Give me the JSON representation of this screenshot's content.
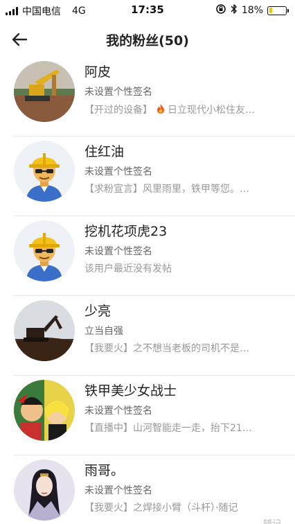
{
  "status_bar": {
    "carrier": "中国电信",
    "network": "4G",
    "time": "17:35",
    "battery_percent": "18%",
    "battery_level": 0.18,
    "icons": [
      "signal-icon",
      "orientation-lock-icon",
      "bluetooth-icon",
      "battery-icon"
    ]
  },
  "nav": {
    "back_icon": "back-arrow-icon",
    "title": "我的粉丝(50)"
  },
  "fans": [
    {
      "name": "阿皮",
      "signature": "未设置个性签名",
      "post_tag": "【开过的设备】",
      "post_icon": "fire-icon",
      "post_text": "日立现代小松住友…",
      "avatar": "excavator-photo"
    },
    {
      "name": "住红油",
      "signature": "未设置个性签名",
      "post_tag": "【求粉宣言】",
      "post_text": "风里雨里，铁甲等您。…",
      "avatar": "worker-cartoon"
    },
    {
      "name": "挖机花项虎23",
      "signature": "未设置个性签名",
      "post_tag": "",
      "post_text": "该用户最近没有发帖",
      "avatar": "worker-cartoon"
    },
    {
      "name": "少亮",
      "signature": "立当自强",
      "post_tag": "【我要火】",
      "post_text": "之不想当老板的司机不是…",
      "avatar": "excavator-silhouette-photo"
    },
    {
      "name": "铁甲美少女战士",
      "signature": "未设置个性签名",
      "post_tag": "【直播中】",
      "post_text": "山河智能走一走，抬下21…",
      "avatar": "anime-photo"
    },
    {
      "name": "雨哥。",
      "signature": "未设置个性签名",
      "post_tag": "【我要火】",
      "post_text": "之焊接小臂（斗杆）·随记",
      "avatar": "illustration-photo"
    }
  ],
  "watermark": "随记",
  "colors": {
    "battery": "#f2c200",
    "divider": "#e8e8e8"
  }
}
